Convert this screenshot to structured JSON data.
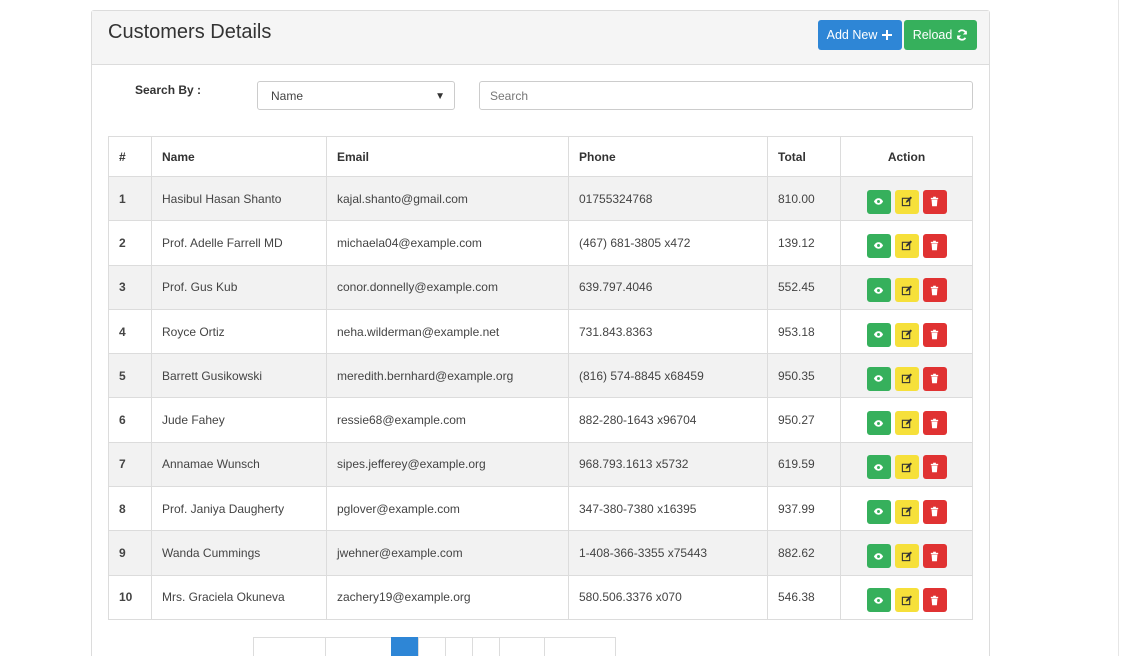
{
  "panel": {
    "title": "Customers Details",
    "add_button_label": "Add New",
    "reload_button_label": "Reload"
  },
  "search": {
    "label": "Search By :",
    "selected_field": "Name",
    "placeholder": "Search"
  },
  "table": {
    "headers": [
      "#",
      "Name",
      "Email",
      "Phone",
      "Total",
      "Action"
    ],
    "rows": [
      {
        "num": "1",
        "name": "Hasibul Hasan Shanto",
        "email": "kajal.shanto@gmail.com",
        "phone": "01755324768",
        "total": "810.00"
      },
      {
        "num": "2",
        "name": "Prof. Adelle Farrell MD",
        "email": "michaela04@example.com",
        "phone": "(467) 681-3805 x472",
        "total": "139.12"
      },
      {
        "num": "3",
        "name": "Prof. Gus Kub",
        "email": "conor.donnelly@example.com",
        "phone": "639.797.4046",
        "total": "552.45"
      },
      {
        "num": "4",
        "name": "Royce Ortiz",
        "email": "neha.wilderman@example.net",
        "phone": "731.843.8363",
        "total": "953.18"
      },
      {
        "num": "5",
        "name": "Barrett Gusikowski",
        "email": "meredith.bernhard@example.org",
        "phone": "(816) 574-8845 x68459",
        "total": "950.35"
      },
      {
        "num": "6",
        "name": "Jude Fahey",
        "email": "ressie68@example.com",
        "phone": "882-280-1643 x96704",
        "total": "950.27"
      },
      {
        "num": "7",
        "name": "Annamae Wunsch",
        "email": "sipes.jefferey@example.org",
        "phone": "968.793.1613 x5732",
        "total": "619.59"
      },
      {
        "num": "8",
        "name": "Prof. Janiya Daugherty",
        "email": "pglover@example.com",
        "phone": "347-380-7380 x16395",
        "total": "937.99"
      },
      {
        "num": "9",
        "name": "Wanda Cummings",
        "email": "jwehner@example.com",
        "phone": "1-408-366-3355 x75443",
        "total": "882.62"
      },
      {
        "num": "10",
        "name": "Mrs. Graciela Okuneva",
        "email": "zachery19@example.org",
        "phone": "580.506.3376 x070",
        "total": "546.38"
      }
    ]
  },
  "icons": {
    "add": "plus-icon",
    "reload": "refresh-icon",
    "view": "eye-icon",
    "edit": "edit-icon",
    "delete": "trash-icon",
    "select": "caret-down-icon"
  },
  "colors": {
    "primary": "#2e86d6",
    "success": "#36b05c",
    "warning": "#f6e03a",
    "danger": "#e03232"
  },
  "pagination": {
    "active_page_index": 2,
    "page_count": 8
  }
}
